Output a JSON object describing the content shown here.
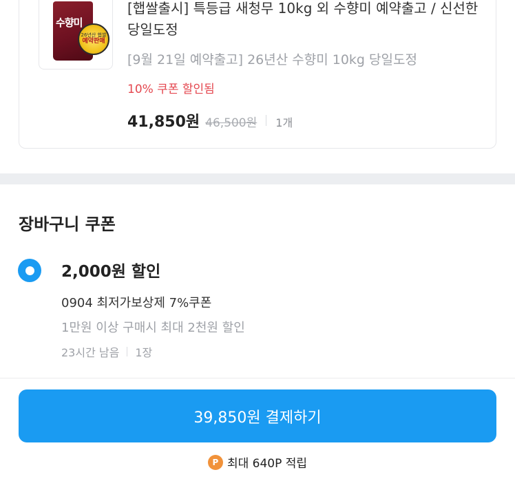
{
  "product": {
    "thumbnail_icon": "rice-bag-icon",
    "thumbnail_brand": "수향미",
    "thumbnail_badge_top": "26년산 햅쌀",
    "thumbnail_badge_main": "예약판매",
    "title": "[햅쌀출시] 특등급 새청무 10kg 외 수향미 예약출고 / 신선한 당일도정",
    "option": "[9월 21일 예약출고] 26년산 수향미 10kg 당일도정",
    "coupon_applied": "10% 쿠폰 할인됨",
    "price_final": "41,850원",
    "price_original": "46,500원",
    "quantity": "1개"
  },
  "cart_coupon": {
    "section_title": "장바구니 쿠폰",
    "selected": true,
    "amount": "2,000원 할인",
    "name": "0904 최저가보상제 7%쿠폰",
    "condition": "1만원 이상 구매시 최대 2천원 할인",
    "time_left": "23시간 남음",
    "count": "1장"
  },
  "bottom": {
    "pay_label": "39,850원 결제하기",
    "points_icon_label": "P",
    "points_text": "최대 640P 적립"
  },
  "colors": {
    "accent": "#1a9bf2",
    "discount_red": "#e4474f",
    "points_orange": "#f1923a",
    "muted_text": "#9ea1a7"
  }
}
